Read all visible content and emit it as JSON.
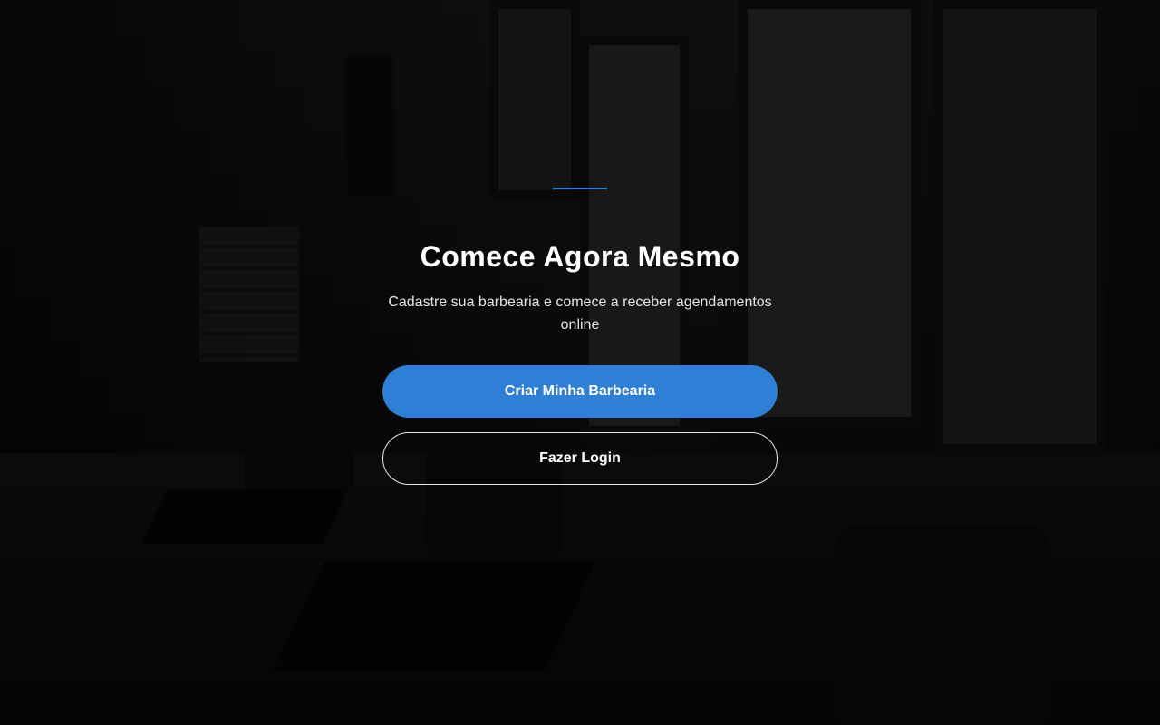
{
  "hero": {
    "title": "Comece Agora Mesmo",
    "subtitle": "Cadastre sua barbearia e comece a receber agendamentos online",
    "accent_color": "#2f7fd6"
  },
  "actions": {
    "primary_label": "Criar Minha Barbearia",
    "secondary_label": "Fazer Login"
  }
}
